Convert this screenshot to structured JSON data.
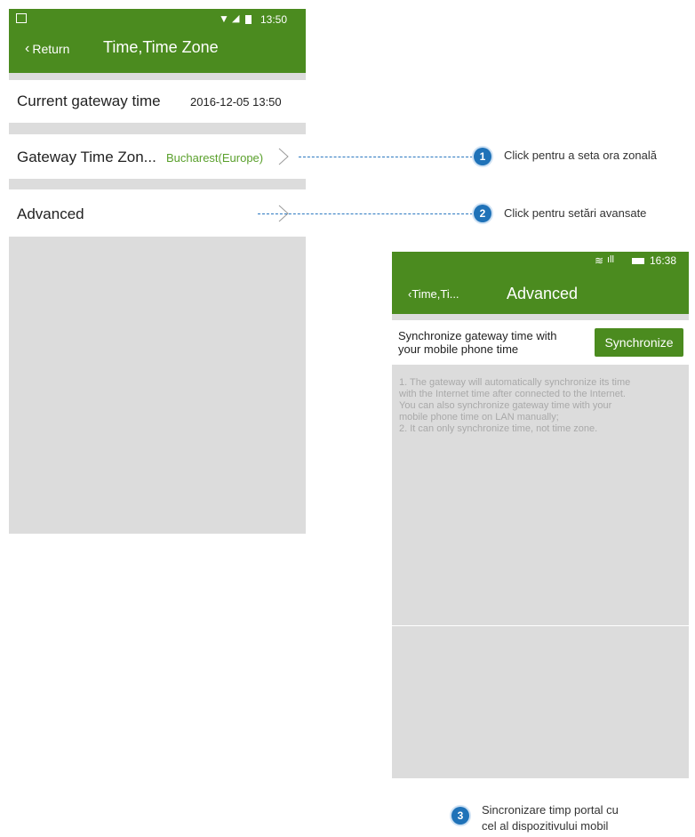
{
  "phone1": {
    "status_time": "13:50",
    "back_label": "Return",
    "title": "Time,Time Zone",
    "current_time": {
      "label": "Current gateway time",
      "value": "2016-12-05 13:50"
    },
    "time_zone": {
      "label": "Gateway Time Zon...",
      "value": "Bucharest(Europe)"
    },
    "advanced": {
      "label": "Advanced"
    }
  },
  "phone2": {
    "status_time": "16:38",
    "back_label": "Time,Ti...",
    "title": "Advanced",
    "sync_description_line1": "Synchronize gateway time with",
    "sync_description_line2": "your mobile phone time",
    "sync_button": "Synchronize",
    "notes": [
      "1. The gateway will automatically synchronize its time",
      "with the Internet time after connected to the Internet.",
      "You can also synchronize gateway time with your",
      "mobile phone time on LAN manually;",
      "2. It can only synchronize time, not time zone."
    ]
  },
  "callouts": [
    {
      "number": "1",
      "text": "Click pentru a seta ora zonală"
    },
    {
      "number": "2",
      "text": "Click pentru setări avansate"
    },
    {
      "number": "3",
      "line1": "Sincronizare timp portal cu",
      "line2": "cel al dispozitivului mobil"
    }
  ],
  "colors": {
    "header_green": "#4b8b1f",
    "value_green": "#5aa02c",
    "callout_blue": "#1f72b8"
  }
}
